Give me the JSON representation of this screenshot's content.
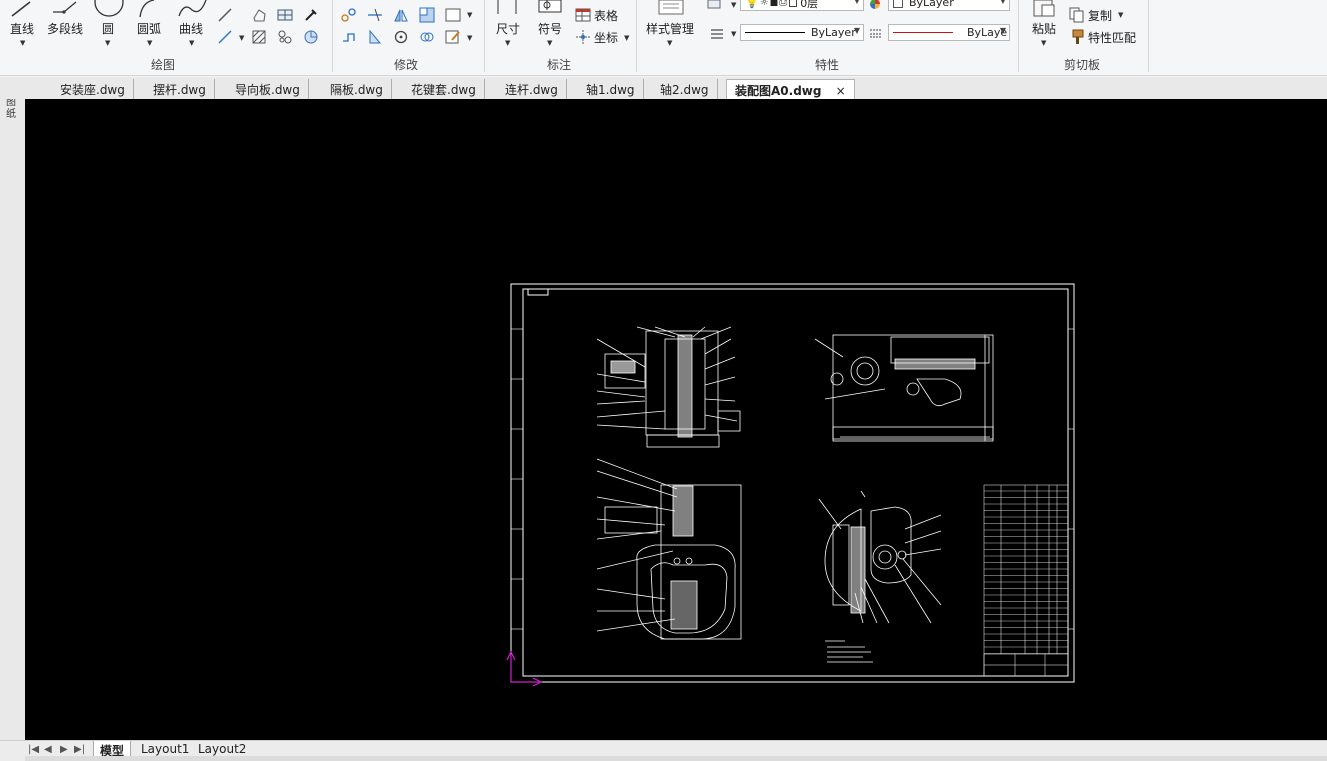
{
  "ribbon": {
    "draw_panel": {
      "label": "绘图",
      "tools": [
        "直线",
        "多段线",
        "圆",
        "圆弧",
        "曲线"
      ]
    },
    "modify_panel": {
      "label": "修改"
    },
    "annotate_panel": {
      "label": "标注",
      "dimension_label": "尺寸",
      "symbol_label": "符号",
      "table_label": "表格",
      "coordinate_label": "坐标"
    },
    "properties_panel": {
      "label": "特性",
      "style_manager_label": "样式管理",
      "layer_value": "0层",
      "color_value": "ByLayer",
      "linetype_value": "ByLayer",
      "lineweight_value": "ByLaye"
    },
    "clipboard_panel": {
      "label": "剪切板",
      "paste_label": "粘贴",
      "copy_label": "复制",
      "match_props_label": "特性匹配"
    }
  },
  "side_strip": {
    "label": "图 纸"
  },
  "document_tabs": [
    {
      "label": "安装座.dwg"
    },
    {
      "label": "摆杆.dwg"
    },
    {
      "label": "导向板.dwg"
    },
    {
      "label": "隔板.dwg"
    },
    {
      "label": "花键套.dwg"
    },
    {
      "label": "连杆.dwg"
    },
    {
      "label": "轴1.dwg"
    },
    {
      "label": "轴2.dwg"
    },
    {
      "label": "装配图A0.dwg",
      "active": true,
      "close": "×"
    }
  ],
  "layout_tabs": [
    {
      "label": "模型",
      "active": true
    },
    {
      "label": "Layout1"
    },
    {
      "label": "Layout2"
    }
  ],
  "colors": {
    "canvas_bg": "#000000",
    "drawing_line": "#ffffff",
    "ucs_icon": "#d020d0",
    "linetype_preview": "#000000",
    "lineweight_preview": "#d01010"
  }
}
